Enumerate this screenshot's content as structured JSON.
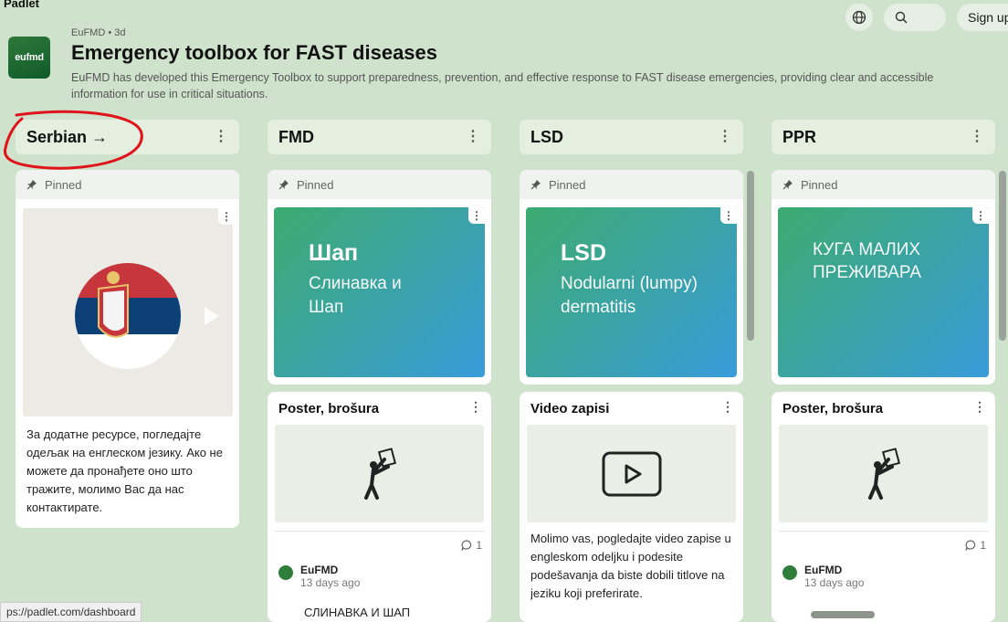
{
  "app": {
    "brand": "Padlet",
    "signup_label": "Sign up"
  },
  "board": {
    "meta": "EuFMD • 3d",
    "logo_text": "eufmd",
    "title": "Emergency toolbox for FAST diseases",
    "description": "EuFMD has developed this Emergency Toolbox to support preparedness, prevention, and effective response to FAST disease emergencies, providing clear and accessible information for use in critical situations."
  },
  "pinned_label": "Pinned",
  "columns": [
    {
      "title": "Serbian →",
      "pinned_text": "За додатне ресурсе, погледајте одељак на енглеском језику. Ако не можете да пронађете оно што тражите, молимо Вас да нас контактирате."
    },
    {
      "title": "FMD",
      "banner": {
        "big": "Шап",
        "sub": "Слинавка и Шап"
      },
      "post": {
        "title": "Poster, brošura",
        "comments": "1",
        "author": "EuFMD",
        "time": "13 days ago",
        "excerpt": "СЛИНАВКА И ШАП"
      }
    },
    {
      "title": "LSD",
      "banner": {
        "big": "LSD",
        "sub": "Nodularni (lumpy) dermatitis"
      },
      "post": {
        "title": "Video zapisi",
        "body": "Molimo vas, pogledajte video zapise u engleskom odeljku i podesite podešavanja da biste dobili titlove na jeziku koji preferirate."
      }
    },
    {
      "title": "PPR",
      "banner": {
        "light": "КУГА МАЛИХ ПРЕЖИВАРА"
      },
      "post": {
        "title": "Poster, brošura",
        "comments": "1",
        "author": "EuFMD",
        "time": "13 days ago"
      }
    }
  ],
  "status_url": "ps://padlet.com/dashboard",
  "colors": {
    "background": "#cfe3cc",
    "banner_start": "#3cab6f",
    "banner_end": "#3a9bda",
    "annotation": "#e0131b"
  }
}
